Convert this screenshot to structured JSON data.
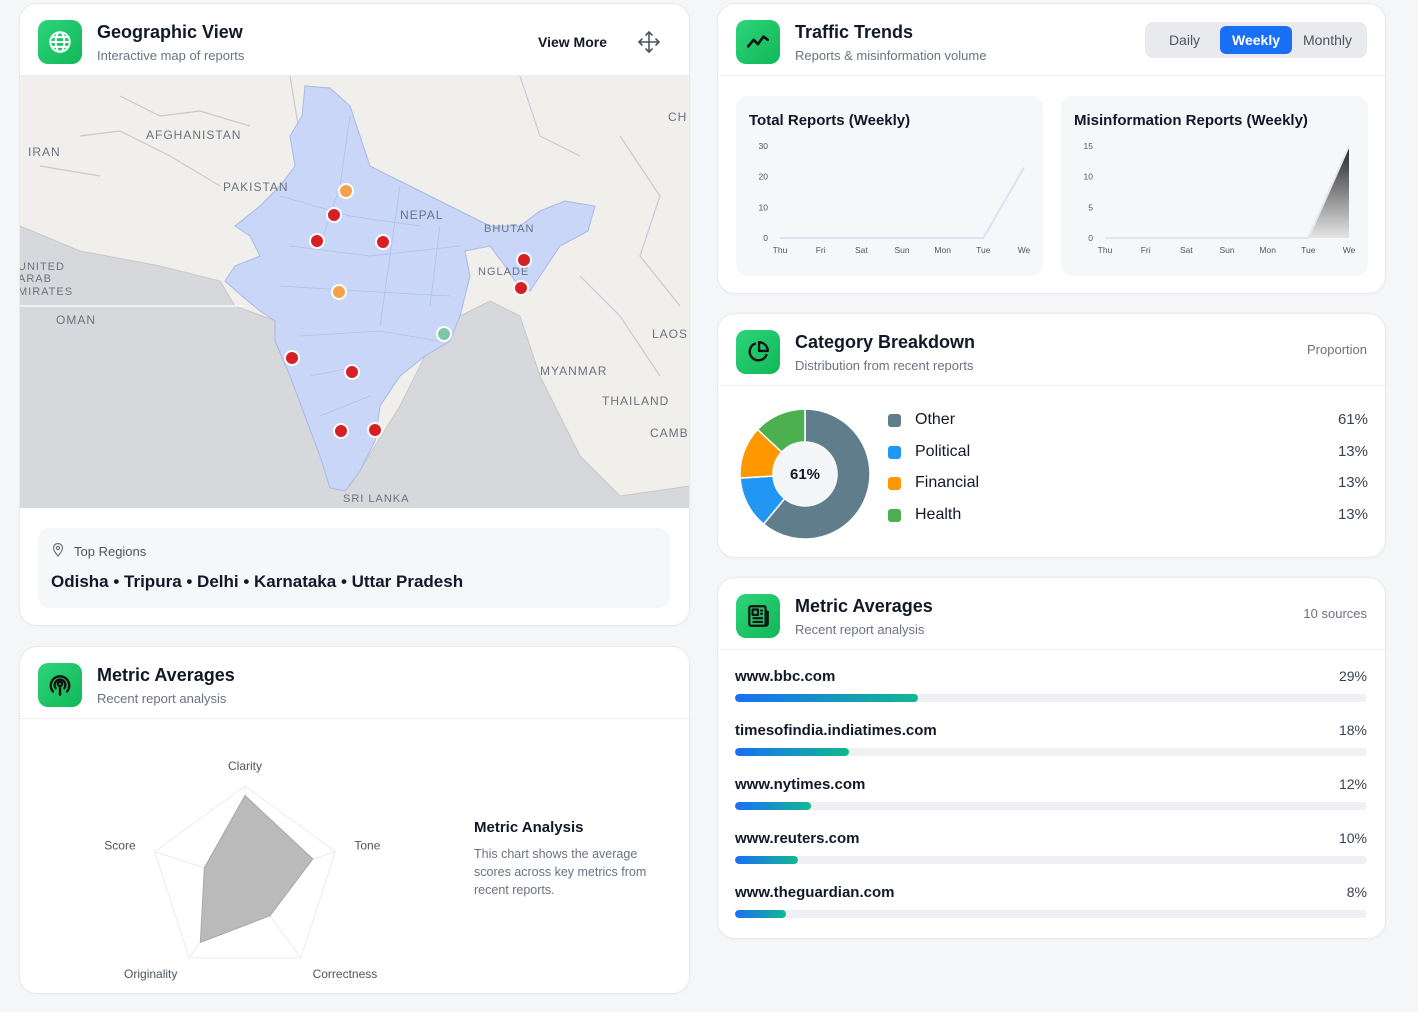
{
  "geo": {
    "title": "Geographic View",
    "subtitle": "Interactive map of reports",
    "view_more": "View More",
    "map_labels": [
      "AFGHANISTAN",
      "IRAN",
      "PAKISTAN",
      "NEPAL",
      "BHUTAN",
      "NGLADE",
      "UNITED",
      "ARAB",
      "MIRATES",
      "OMAN",
      "MYANMAR",
      "THAILAND",
      "LAOS",
      "CAMB",
      "SRI LANKA",
      "CH"
    ],
    "top_regions_label": "Top Regions",
    "top_regions": "Odisha • Tripura • Delhi • Karnataka • Uttar Pradesh"
  },
  "traffic": {
    "title": "Traffic Trends",
    "subtitle": "Reports & misinformation volume",
    "tabs": [
      "Daily",
      "Weekly",
      "Monthly"
    ],
    "active_tab": "Weekly",
    "total_title": "Total Reports (Weekly)",
    "misinfo_title": "Misinformation Reports (Weekly)"
  },
  "category": {
    "title": "Category Breakdown",
    "subtitle": "Distribution from recent reports",
    "right_label": "Proportion",
    "center_label": "61%",
    "colors": {
      "Other": "#607d8b",
      "Political": "#2196f3",
      "Financial": "#ff9800",
      "Health": "#4caf50"
    },
    "items": [
      {
        "name": "Other",
        "pct": "61%"
      },
      {
        "name": "Political",
        "pct": "13%"
      },
      {
        "name": "Financial",
        "pct": "13%"
      },
      {
        "name": "Health",
        "pct": "13%"
      }
    ]
  },
  "sources": {
    "title": "Metric Averages",
    "subtitle": "Recent report analysis",
    "right_label": "10 sources",
    "items": [
      {
        "name": "www.bbc.com",
        "pct": "29%",
        "value": 29
      },
      {
        "name": "timesofindia.indiatimes.com",
        "pct": "18%",
        "value": 18
      },
      {
        "name": "www.nytimes.com",
        "pct": "12%",
        "value": 12
      },
      {
        "name": "www.reuters.com",
        "pct": "10%",
        "value": 10
      },
      {
        "name": "www.theguardian.com",
        "pct": "8%",
        "value": 8
      }
    ]
  },
  "metrics": {
    "title": "Metric Averages",
    "subtitle": "Recent report analysis",
    "analysis_title": "Metric Analysis",
    "analysis_text": "This chart shows the average scores across key metrics from recent reports."
  },
  "chart_data": [
    {
      "type": "line",
      "title": "Total Reports (Weekly)",
      "x": [
        "Thu",
        "Fri",
        "Sat",
        "Sun",
        "Mon",
        "Tue",
        "We"
      ],
      "values": [
        0,
        0,
        0,
        0,
        0,
        0,
        23
      ],
      "ylim": [
        0,
        30
      ],
      "yticks": [
        0,
        10,
        20,
        30
      ]
    },
    {
      "type": "area",
      "title": "Misinformation Reports (Weekly)",
      "x": [
        "Thu",
        "Fri",
        "Sat",
        "Sun",
        "Mon",
        "Tue",
        "We"
      ],
      "values": [
        0,
        0,
        0,
        0,
        0,
        0,
        15
      ],
      "ylim": [
        0,
        15
      ],
      "yticks": [
        0,
        5,
        10,
        15
      ]
    },
    {
      "type": "pie",
      "categories": [
        "Other",
        "Political",
        "Financial",
        "Health"
      ],
      "values": [
        61,
        13,
        13,
        13
      ]
    },
    {
      "type": "bar",
      "categories": [
        "www.bbc.com",
        "timesofindia.indiatimes.com",
        "www.nytimes.com",
        "www.reuters.com",
        "www.theguardian.com"
      ],
      "values": [
        29,
        18,
        12,
        10,
        8
      ]
    },
    {
      "type": "radar",
      "categories": [
        "Clarity",
        "Tone",
        "Correctness",
        "Originality",
        "Score"
      ],
      "values": [
        0.9,
        0.75,
        0.45,
        0.8,
        0.45
      ],
      "max": 1
    }
  ]
}
